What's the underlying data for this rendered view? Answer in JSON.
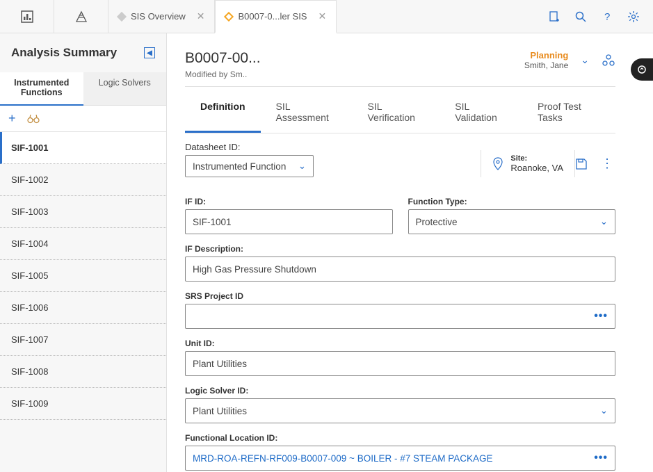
{
  "topbar": {
    "tab1_label": "SIS Overview",
    "tab2_label": "B0007-0...ler SIS"
  },
  "left": {
    "title": "Analysis Summary",
    "tab_instrumented_line1": "Instrumented",
    "tab_instrumented_line2": "Functions",
    "tab_logic_solvers": "Logic Solvers",
    "items": [
      "SIF-1001",
      "SIF-1002",
      "SIF-1003",
      "SIF-1004",
      "SIF-1005",
      "SIF-1006",
      "SIF-1007",
      "SIF-1008",
      "SIF-1009"
    ],
    "selected_index": 0
  },
  "header": {
    "title": "B0007-00...",
    "subtitle": "Modified by Sm..",
    "status_label": "Planning",
    "status_user": "Smith, Jane"
  },
  "tabs": {
    "definition": "Definition",
    "sil_assessment": "SIL Assessment",
    "sil_verification": "SIL Verification",
    "sil_validation": "SIL Validation",
    "proof_test": "Proof Test Tasks",
    "active": "definition"
  },
  "datasheet": {
    "label": "Datasheet ID:",
    "value": "Instrumented Function",
    "site_label": "Site:",
    "site_value": "Roanoke, VA"
  },
  "fields": {
    "if_id_label": "IF ID:",
    "if_id_value": "SIF-1001",
    "function_type_label": "Function Type:",
    "function_type_value": "Protective",
    "if_desc_label": "IF Description:",
    "if_desc_value": "High Gas Pressure Shutdown",
    "srs_label": "SRS Project ID",
    "srs_value": "",
    "unit_id_label": "Unit ID:",
    "unit_id_value": "Plant Utilities",
    "logic_solver_label": "Logic Solver ID:",
    "logic_solver_value": "Plant Utilities",
    "func_loc_label": "Functional Location ID:",
    "func_loc_value": "MRD-ROA-REFN-RF009-B0007-009 ~ BOILER - #7 STEAM PACKAGE"
  }
}
